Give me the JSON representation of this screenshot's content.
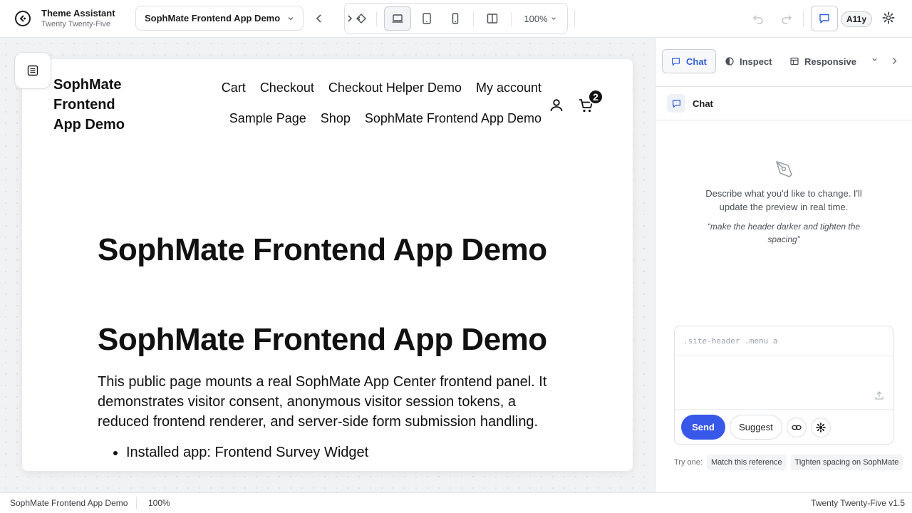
{
  "topbar": {
    "title": "Theme Assistant",
    "subtitle": "Twenty Twenty-Five",
    "page_select": "SophMate Frontend App Demo",
    "zoom": "100%",
    "a11y": "A11y"
  },
  "preview": {
    "site_title": "SophMate Frontend App Demo",
    "nav": [
      "Cart",
      "Checkout",
      "Checkout Helper Demo",
      "My account",
      "Sample Page",
      "Shop",
      "SophMate Frontend App Demo"
    ],
    "cart_count": "2",
    "hero_title": "SophMate Frontend App Demo",
    "page_heading": "SophMate Frontend App Demo",
    "body_text": "This public page mounts a real SophMate App Center frontend panel. It demonstrates visitor consent, anonymous visitor session tokens, a reduced frontend renderer, and server-side form submission handling.",
    "list": [
      {
        "label": "Installed app: ",
        "value": "Frontend Survey Widget"
      }
    ]
  },
  "panel": {
    "tabs": [
      {
        "label": "Chat",
        "icon": "chat-bubble-icon",
        "active": true
      },
      {
        "label": "Inspect",
        "icon": "half-circle-icon",
        "active": false
      },
      {
        "label": "Responsive",
        "icon": "layout-icon",
        "active": false
      }
    ],
    "chat_title": "Chat",
    "empty_text": "Describe what you'd like to change. I'll update the preview in real time.",
    "empty_example": "“make the header darker and tighten the spacing”",
    "selector_placeholder": ".site-header .menu a",
    "send_label": "Send",
    "suggest_label": "Suggest",
    "try_label": "Try one:",
    "suggestions": [
      "Match this reference",
      "Tighten spacing on SophMate"
    ]
  },
  "statusbar": {
    "page": "SophMate Frontend App Demo",
    "zoom": "100%",
    "theme": "Twenty Twenty-Five v1.5"
  },
  "colors": {
    "accent": "#3858e9",
    "accent_icon": "#2f5dd6"
  }
}
